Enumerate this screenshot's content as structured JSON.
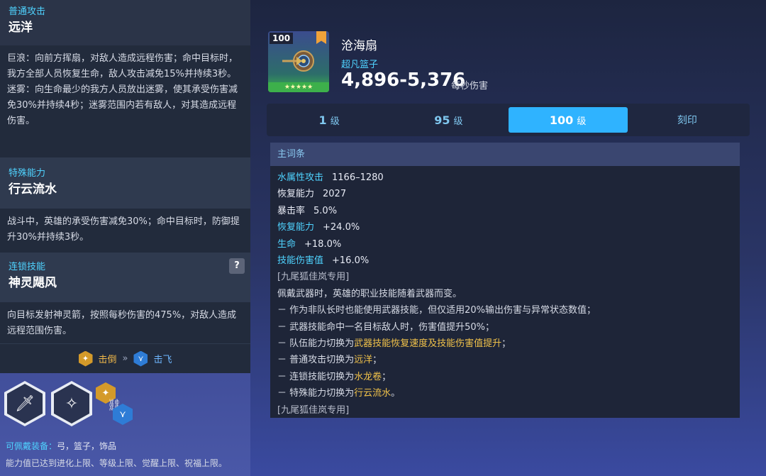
{
  "left": {
    "basic": {
      "category": "普通攻击",
      "name": "远洋",
      "desc": "巨浪：向前方挥扇，对敌人造成远程伤害；命中目标时，我方全部人员恢复生命，敌人攻击减免15%并持续3秒。迷雾：向生命最少的我方人员放出迷雾，使其承受伤害减免30%并持续4秒；迷雾范围内若有敌人，对其造成远程伤害。"
    },
    "special": {
      "category": "特殊能力",
      "name": "行云流水",
      "desc": "战斗中，英雄的承受伤害减免30%；命中目标时，防御提升30%并持续3秒。"
    },
    "chain": {
      "category": "连锁技能",
      "name": "神灵飓风",
      "help": "?",
      "desc": "向目标发射神灵箭，按照每秒伤害的475%，对敌人造成远程范围伤害。",
      "from_label": "击倒",
      "to_label": "击飞"
    },
    "equip_label": "可佩戴装备：",
    "equip_value": "弓，篮子，饰品",
    "limit_text": "能力值已达到进化上限、等级上限、觉醒上限、祝福上限。",
    "icons": [
      "sword-icon",
      "sparkle-icon"
    ]
  },
  "item": {
    "level": "100",
    "stars": "★★★★★",
    "title": "沧海扇",
    "type": "超凡篮子",
    "damage": "4,896-5,376",
    "damage_label": "每秒伤害"
  },
  "tabs": [
    {
      "num": "1",
      "unit": "级"
    },
    {
      "num": "95",
      "unit": "级"
    },
    {
      "num": "100",
      "unit": "级"
    },
    {
      "num": "刻印",
      "unit": ""
    }
  ],
  "attributes": {
    "header": "主词条",
    "rows": [
      {
        "key": "水属性攻击",
        "value": "1166–1280"
      },
      {
        "key": "恢复能力",
        "value": "2027"
      },
      {
        "key": "暴击率",
        "value": "5.0%"
      },
      {
        "key": "恢复能力",
        "value": "+24.0%"
      },
      {
        "key": "生命",
        "value": "+18.0%"
      },
      {
        "key": "技能伤害值",
        "value": "+16.0%"
      }
    ],
    "exclusive_note": "[九尾狐佳岚专用]",
    "intro": "佩戴武器时，英雄的职业技能随着武器而变。",
    "line1": "－ 作为非队长时也能使用武器技能，但仅适用20%输出伤害与异常状态数值；",
    "line2": "－ 武器技能命中一名目标敌人时，伤害值提升50%；",
    "line3_pre": "－ 队伍能力切换为",
    "line3_hl": "武器技能恢复速度及技能伤害值提升",
    "line3_post": "；",
    "line4_pre": "－ 普通攻击切换为",
    "line4_hl": "远洋",
    "line4_post": "；",
    "line5_pre": "－ 连锁技能切换为",
    "line5_hl": "水龙卷",
    "line5_post": "；",
    "line6_pre": "－ 特殊能力切换为",
    "line6_hl": "行云流水",
    "line6_post": "。",
    "exclusive_note2": "[九尾狐佳岚专用]"
  }
}
